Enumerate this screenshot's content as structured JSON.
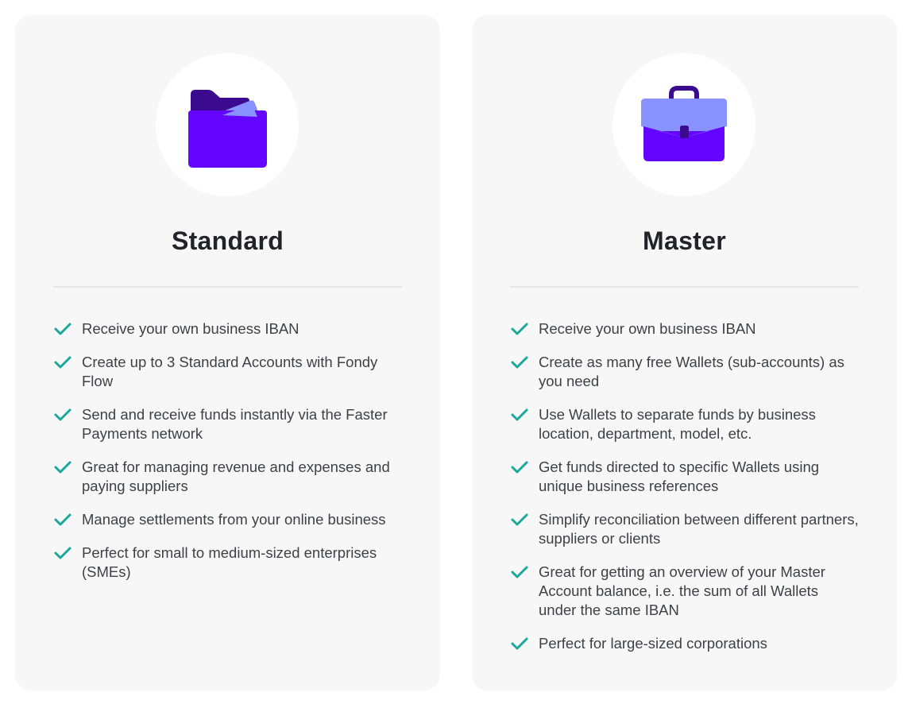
{
  "colors": {
    "card_bg": "#f7f7f7",
    "check": "#1aa89a",
    "icon_primary": "#6406ff",
    "icon_dark": "#3a0a8f",
    "icon_light": "#8993ff",
    "title": "#22222a",
    "body_text": "#3f4048"
  },
  "plans": [
    {
      "name": "Standard",
      "icon": "folder-icon",
      "features": [
        "Receive your own business IBAN",
        "Create up to 3 Standard Accounts with Fondy Flow",
        "Send and receive funds instantly via the Faster Payments network",
        "Great for managing revenue and expenses and paying suppliers",
        "Manage settlements from your online business",
        "Perfect for small to medium-sized enterprises (SMEs)"
      ]
    },
    {
      "name": "Master",
      "icon": "briefcase-icon",
      "features": [
        "Receive your own business IBAN",
        "Create as many free Wallets (sub-accounts) as you need",
        "Use Wallets to separate funds by business location, department, model, etc.",
        "Get funds directed to specific Wallets using unique business references",
        "Simplify reconciliation between different partners, suppliers or clients",
        "Great for getting an overview of your Master Account balance, i.e. the sum of all Wallets under the same IBAN",
        "Perfect for large-sized corporations"
      ]
    }
  ]
}
